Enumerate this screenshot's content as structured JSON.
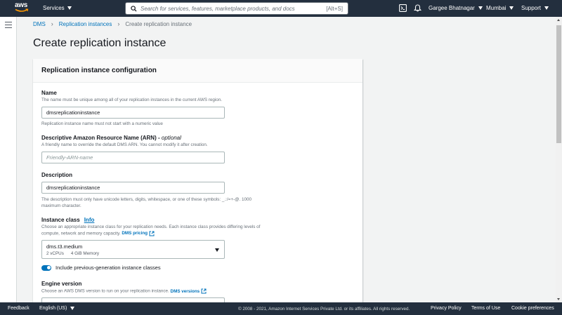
{
  "topnav": {
    "logo_text": "aws",
    "services_label": "Services",
    "search_placeholder": "Search for services, features, marketplace products, and docs",
    "search_shortcut": "[Alt+S]",
    "user_name": "Gargee Bhatnagar",
    "region": "Mumbai",
    "support": "Support"
  },
  "breadcrumb": {
    "items": [
      "DMS",
      "Replication instances"
    ],
    "current": "Create replication instance"
  },
  "page": {
    "title": "Create replication instance"
  },
  "panel": {
    "title": "Replication instance configuration",
    "name": {
      "label": "Name",
      "description": "The name must be unique among all of your replication instances in the current AWS region.",
      "value": "dmsreplicationinstance",
      "hint": "Replication instance name must not start with a numeric value"
    },
    "arn": {
      "label": "Descriptive Amazon Resource Name (ARN) -",
      "optional": "optional",
      "description": "A friendly name to override the default DMS ARN. You cannot modify it after creation.",
      "placeholder": "Friendly-ARN-name"
    },
    "description": {
      "label": "Description",
      "value": "dmsreplicationinstance",
      "hint_line1": "The description must only have unicode letters, digits, whitespace, or one of these symbols: _.:/=+-@. 1000",
      "hint_line2": "maximum character."
    },
    "instance_class": {
      "label": "Instance class",
      "info": "Info",
      "description_line1": "Choose an appropriate instance class for your replication needs. Each instance class provides differing levels of",
      "description_line2": "compute, network and memory capacity.",
      "pricing_link": "DMS pricing",
      "selected": "dms.t3.medium",
      "vcpus": "2 vCPUs",
      "memory": "4 GiB Memory"
    },
    "toggle": {
      "label": "Include previous-generation instance classes",
      "on": true
    },
    "engine_version": {
      "label": "Engine version",
      "description": "Choose an AWS DMS version to run on your replication instance.",
      "link": "DMS versions"
    }
  },
  "footer": {
    "feedback": "Feedback",
    "language": "English (US)",
    "copyright": "© 2008 - 2021, Amazon Internet Services Private Ltd. or its affiliates. All rights reserved.",
    "privacy": "Privacy Policy",
    "terms": "Terms of Use",
    "cookies": "Cookie preferences"
  },
  "colors": {
    "nav_bg": "#232f3e",
    "link": "#0073bb",
    "page_bg": "#f2f3f3"
  },
  "icons": [
    "aws-logo-icon",
    "search-icon",
    "cloudshell-icon",
    "bell-icon",
    "hamburger-icon",
    "external-link-icon"
  ]
}
